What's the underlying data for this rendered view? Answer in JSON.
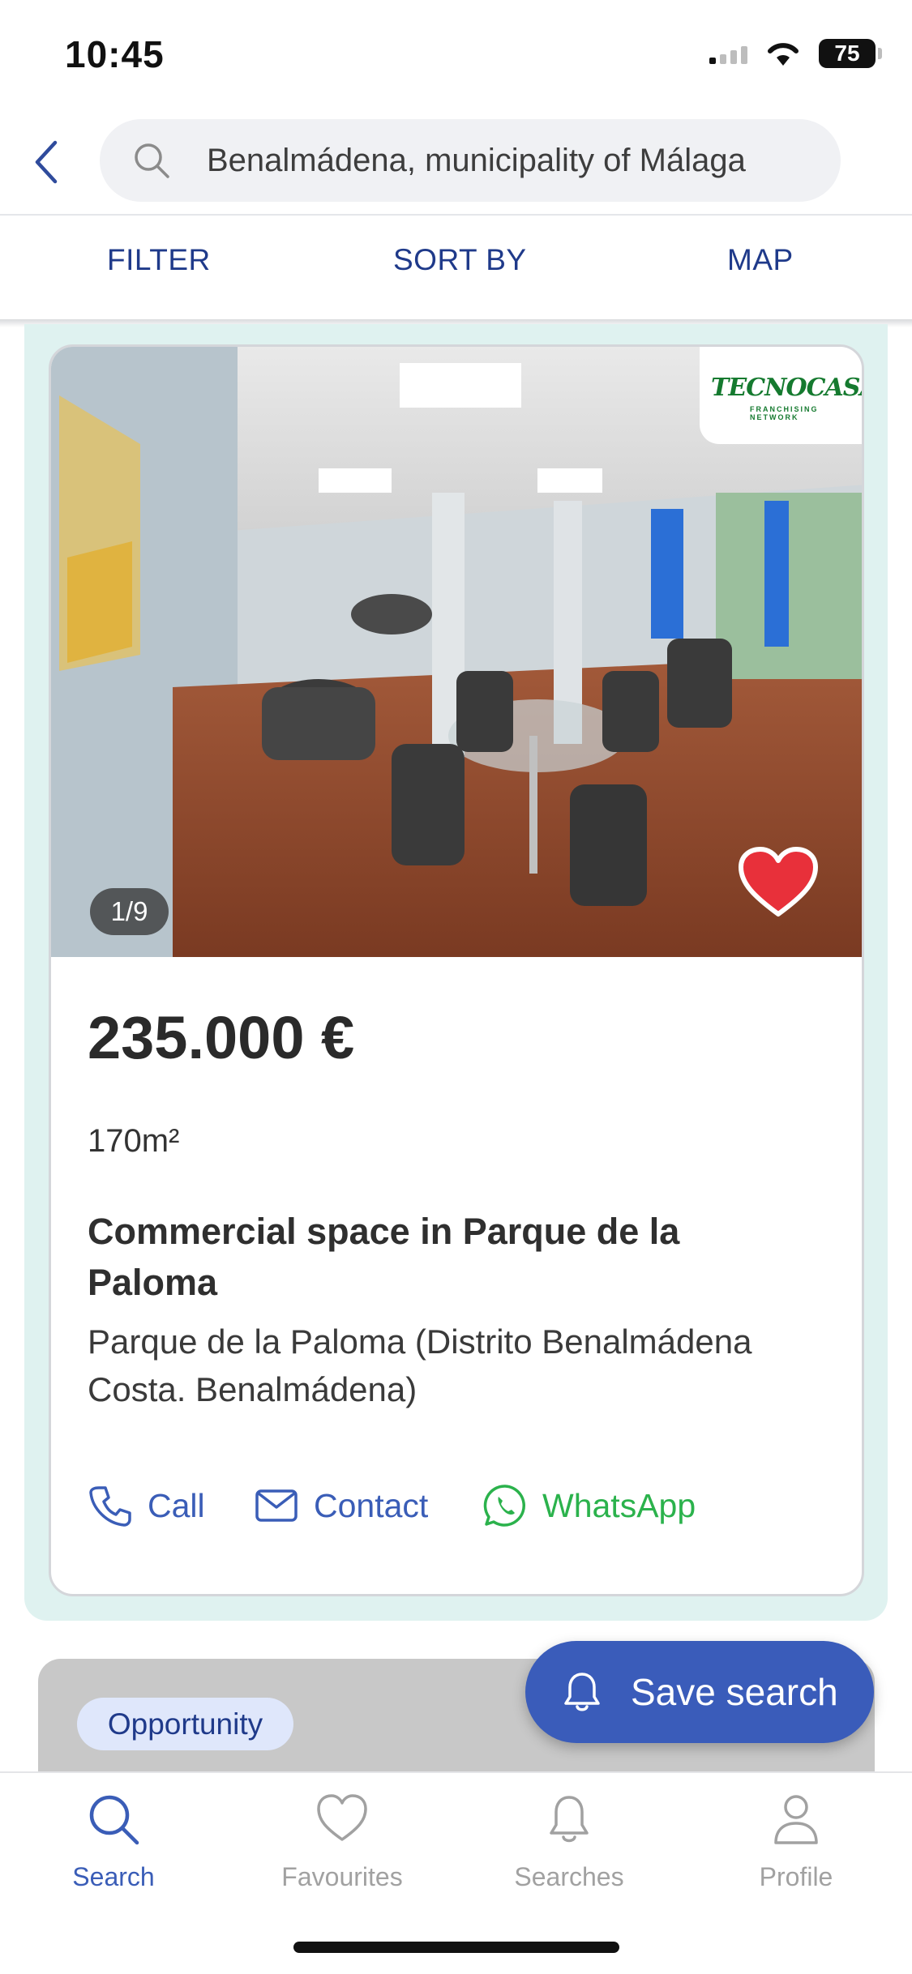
{
  "status_bar": {
    "time": "10:45",
    "battery": "75"
  },
  "search": {
    "query": "Benalmádena, municipality of Málaga"
  },
  "tabs": [
    {
      "label": "FILTER"
    },
    {
      "label": "SORT BY"
    },
    {
      "label": "MAP"
    }
  ],
  "listing": {
    "agency": {
      "name": "TECNOCASA",
      "tagline": "FRANCHISING NETWORK"
    },
    "photo_counter": "1/9",
    "favourite": true,
    "price": "235.000 €",
    "area": "170m²",
    "title": "Commercial space in Parque de la Paloma",
    "location": "Parque de la Paloma (Distrito Benalmádena Costa. Benalmádena)",
    "actions": [
      {
        "label": "Call",
        "icon": "phone-icon"
      },
      {
        "label": "Contact",
        "icon": "mail-icon"
      },
      {
        "label": "WhatsApp",
        "icon": "whatsapp-icon"
      }
    ]
  },
  "next_listing": {
    "badge": "Opportunity"
  },
  "save_search": {
    "label": "Save search",
    "icon": "bell-icon"
  },
  "bottom_nav": [
    {
      "label": "Search",
      "icon": "search-icon",
      "active": true
    },
    {
      "label": "Favourites",
      "icon": "heart-icon",
      "active": false
    },
    {
      "label": "Searches",
      "icon": "bell-icon",
      "active": false
    },
    {
      "label": "Profile",
      "icon": "person-icon",
      "active": false
    }
  ],
  "colors": {
    "primary": "#3a5cba",
    "nav_text": "#1f3a8a",
    "whatsapp": "#2bb24c",
    "card_highlight": "#dff2f0",
    "favourite": "#e8303a"
  }
}
